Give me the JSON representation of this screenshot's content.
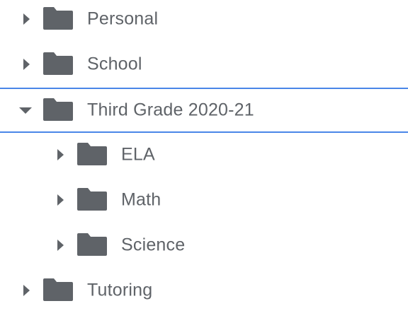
{
  "tree": {
    "items": [
      {
        "label": "Personal",
        "expanded": false,
        "icon": "folder-icon"
      },
      {
        "label": "School",
        "expanded": false,
        "icon": "folder-icon"
      },
      {
        "label": "Third Grade 2020-21",
        "expanded": true,
        "selected": true,
        "icon": "folder-icon"
      },
      {
        "label": "ELA",
        "expanded": false,
        "icon": "folder-icon"
      },
      {
        "label": "Math",
        "expanded": false,
        "icon": "folder-icon"
      },
      {
        "label": "Science",
        "expanded": false,
        "icon": "folder-icon"
      },
      {
        "label": "Tutoring",
        "expanded": false,
        "icon": "folder-icon"
      }
    ]
  },
  "colors": {
    "icon": "#5f6368",
    "text": "#5f6368",
    "selection_border": "#4a86e8"
  }
}
